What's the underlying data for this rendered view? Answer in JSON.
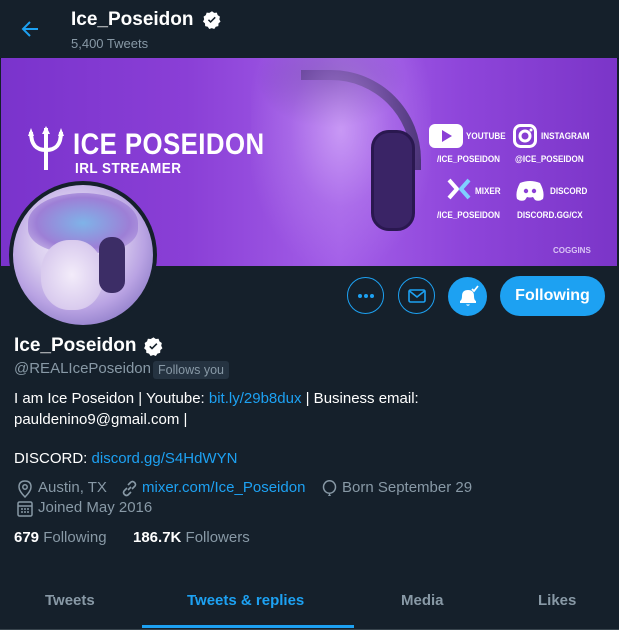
{
  "topbar": {
    "name": "Ice_Poseidon",
    "tweet_count": "5,400 Tweets"
  },
  "banner": {
    "title": "ICE POSEIDON",
    "subtitle": "IRL STREAMER",
    "socials": {
      "youtube_label": "YOUTUBE",
      "youtube_handle": "/ICE_POSEIDON",
      "instagram_label": "INSTAGRAM",
      "instagram_handle": "@ICE_POSEIDON",
      "mixer_label": "MIXER",
      "mixer_handle": "/ICE_POSEIDON",
      "discord_label": "DISCORD",
      "discord_handle": "DISCORD.GG/CX"
    },
    "credit": "COGGINS"
  },
  "actions": {
    "follow_label": "Following"
  },
  "profile": {
    "name": "Ice_Poseidon",
    "handle": "@REALIcePoseidon",
    "follows_you": "Follows you"
  },
  "bio": {
    "line1_prefix": "I am Ice Poseidon |  Youtube: ",
    "youtube_link": "bit.ly/29b8dux",
    "line1_suffix": "   |  Business email:",
    "line2": "pauldenino9@gmail.com |",
    "discord_prefix": "DISCORD: ",
    "discord_link": "discord.gg/S4HdWYN"
  },
  "meta": {
    "location": "Austin, TX",
    "website": "mixer.com/Ice_Poseidon",
    "birthday": "Born September 29",
    "joined": "Joined May 2016"
  },
  "counts": {
    "following_num": "679",
    "following_label": "Following",
    "followers_num": "186.7K",
    "followers_label": "Followers"
  },
  "tabs": [
    {
      "label": "Tweets"
    },
    {
      "label": "Tweets & replies"
    },
    {
      "label": "Media"
    },
    {
      "label": "Likes"
    }
  ],
  "colors": {
    "background": "#15202b",
    "accent": "#1da1f2",
    "muted": "#8899a6",
    "banner": "#8a3fd6"
  }
}
